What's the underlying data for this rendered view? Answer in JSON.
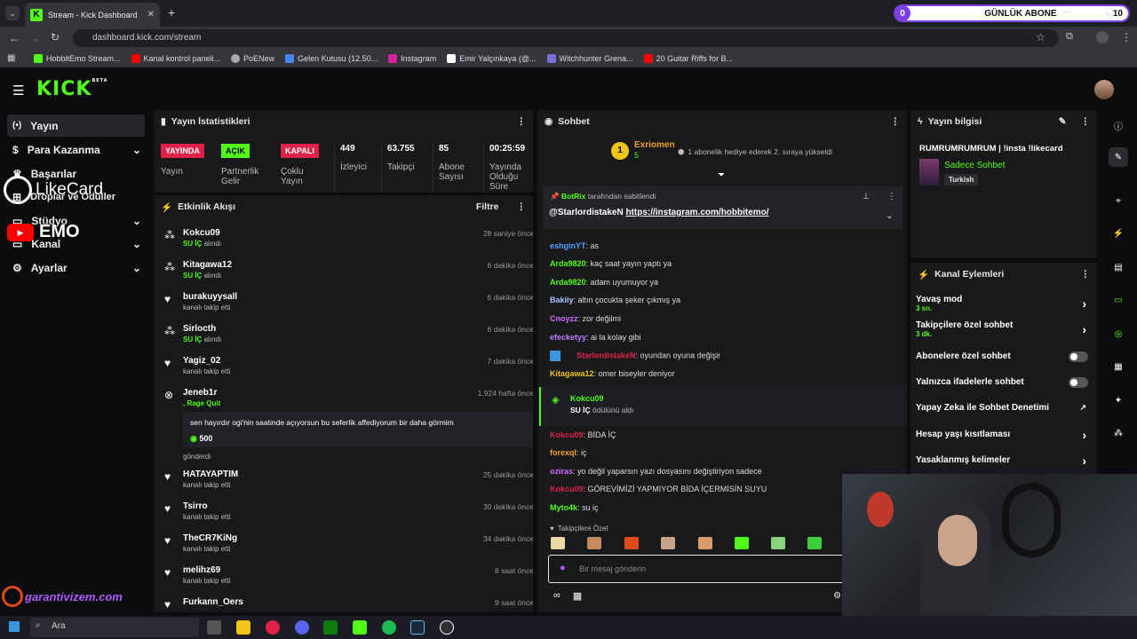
{
  "browser": {
    "tab_title": "Stream - Kick Dashboard",
    "url": "dashboard.kick.com/stream",
    "bookmarks": [
      "HobbitEmo Stream...",
      "Kanal kontrol paneli...",
      "PoENew",
      "Gelen Kutusu (12.50...",
      "Instagram",
      "Emir Yalçınkaya (@...",
      "Witchhunter Grena...",
      "20 Guitar Riffs for B..."
    ]
  },
  "goal": {
    "count": "0",
    "label": "GÜNLÜK ABONE",
    "target": "10"
  },
  "logo": "KICK",
  "logo_beta": "BETA",
  "nav": {
    "items": [
      "Yayın",
      "Para Kazanma",
      "Başarılar",
      "Droplar ve Ödüller",
      "Stüdyo",
      "Kanal",
      "Ayarlar"
    ]
  },
  "overlays": {
    "likecard": "LikeCard",
    "emo": "EMO",
    "garanti": "garantivizem.com"
  },
  "stats": {
    "title": "Yayın İstatistikleri",
    "items": [
      {
        "badge": "YAYINDA",
        "label": "Yayın"
      },
      {
        "badge": "AÇIK",
        "label": "Partnerlik Gelir"
      },
      {
        "badge": "KAPALI",
        "label": "Çoklu Yayın"
      },
      {
        "value": "449",
        "label": "İzleyici"
      },
      {
        "value": "63.755",
        "label": "Takipçi"
      },
      {
        "value": "85",
        "label": "Abone Sayısı"
      },
      {
        "value": "00:25:59",
        "label": "Yayında Olduğu Süre"
      }
    ]
  },
  "activity": {
    "title": "Etkinlik Akışı",
    "filter": "Filtre",
    "items": [
      {
        "name": "Kokcu09",
        "sub1": "SU İÇ",
        "sub2": " alındı",
        "time": "28 saniye önce",
        "icon": "redeem"
      },
      {
        "name": "Kitagawa12",
        "sub1": "SU İÇ",
        "sub2": " alındı",
        "time": "6 dakika önce",
        "icon": "redeem"
      },
      {
        "name": "burakuyysall",
        "sub2": "kanalı takip etti",
        "time": "6 dakika önce",
        "icon": "heart"
      },
      {
        "name": "Sirlocth",
        "sub1": "SU İÇ",
        "sub2": " alındı",
        "time": "6 dakika önce",
        "icon": "redeem"
      },
      {
        "name": "Yagiz_02",
        "sub2": "kanalı takip etti",
        "time": "7 dakika önce",
        "icon": "heart"
      },
      {
        "name": "HATAYAPTIM",
        "sub2": "kanalı takip etti",
        "time": "25 dakika önce",
        "icon": "heart"
      },
      {
        "name": "Tsirro",
        "sub2": "kanalı takip etti",
        "time": "30 dakika önce",
        "icon": "heart"
      },
      {
        "name": "TheCR7KiNg",
        "sub2": "kanalı takip etti",
        "time": "34 dakika önce",
        "icon": "heart"
      },
      {
        "name": "melihz69",
        "sub2": "kanalı takip etti",
        "time": "8 saat önce",
        "icon": "heart"
      },
      {
        "name": "Furkann_Oers",
        "sub2": "",
        "time": "9 saat önce",
        "icon": "heart"
      }
    ],
    "special": {
      "name": "Jeneb1r",
      "reward": ", Rage Quit",
      "time": "1.924 hafta önce",
      "message": "sen hayırdır ogi'nin saatinde açıyorsun bu seferlik affediyorum bir daha görmim",
      "amount": "500",
      "footer": "gönderdi"
    }
  },
  "chat": {
    "title": "Sohbet",
    "gifter": {
      "name": "Exriomen",
      "count": "5",
      "rank": "1",
      "text": "1 abonelik hediye ederek 2. sıraya yükseldi"
    },
    "pinned": {
      "by": "BotRix",
      "by_suffix": " tarafından sabitlendi",
      "mention": "@StarlordistakeN",
      "link": "https://instagram.com/hobbitemo/"
    },
    "messages": [
      {
        "user": "eshginYT",
        "text": ": as",
        "color": "#5aa0ff"
      },
      {
        "user": "Arda9820",
        "text": ": kaç saat yayın yaptı ya",
        "color": "#53fc18"
      },
      {
        "user": "Arda9820",
        "text": ": adam uyumuyor ya",
        "color": "#53fc18"
      },
      {
        "user": "Bakiiy",
        "text": ": altın çocukta şeker çıkmış ya",
        "color": "#a9c8ff"
      },
      {
        "user": "Cnoyzz",
        "text": ": zor değilmi",
        "color": "#d26cff"
      },
      {
        "user": "efecketyy",
        "text": ": ai la kolay gibi",
        "color": "#c77dff"
      },
      {
        "user": "StarlordistakeN",
        "text": ": oyundan oyuna değişir",
        "color": "#e0224a"
      },
      {
        "user": "Kitagawa12",
        "text": ": omer biseyler deniyor",
        "color": "#f0c419"
      },
      {
        "user": "Kokcu09",
        "text": ": BİDA İÇ",
        "color": "#e0224a"
      },
      {
        "user": "forexql",
        "text": ": iç",
        "color": "#f0a030"
      },
      {
        "user": "oziras",
        "text": ": yo değil yaparsın yazı dosyasını değiştiriyon sadece",
        "color": "#d26cff"
      },
      {
        "user": "Kokcu09",
        "text": ": GÖREVİMİZİ YAPMIYOR BİDA İÇERMİSİN SUYU",
        "color": "#e0224a"
      },
      {
        "user": "Myto4k",
        "text": ": su iç",
        "color": "#53fc18"
      }
    ],
    "redeem": {
      "user": "Kokcu09",
      "reward": "SU İÇ",
      "suffix": " ödülünü aldı"
    },
    "followers_only": "Takipçilere Özel",
    "placeholder": "Bir mesaj gönderin"
  },
  "info": {
    "title": "Yayın bilgisi",
    "stream_title": "RUMRUMRUMRUM | !insta !likecard",
    "category": "Sadece Sohbet",
    "language": "Turkish"
  },
  "actions": {
    "title": "Kanal Eylemleri",
    "items": [
      {
        "label": "Yavaş mod",
        "sub": "3 sn.",
        "type": "arrow"
      },
      {
        "label": "Takipçilere özel sohbet",
        "sub": "3 dk.",
        "type": "arrow"
      },
      {
        "label": "Abonelere özel sohbet",
        "type": "toggle"
      },
      {
        "label": "Yalnızca ifadelerle sohbet",
        "type": "toggle"
      },
      {
        "label": "Yapay Zeka ile Sohbet Denetimi",
        "type": "link"
      },
      {
        "label": "Hesap yaşı kısıtlaması",
        "type": "arrow"
      },
      {
        "label": "Yasaklanmış kelimeler",
        "type": "arrow"
      }
    ]
  },
  "taskbar": {
    "search": "Ara"
  },
  "colors": {
    "kick_green": "#53fc18",
    "live_red": "#e0224a"
  }
}
